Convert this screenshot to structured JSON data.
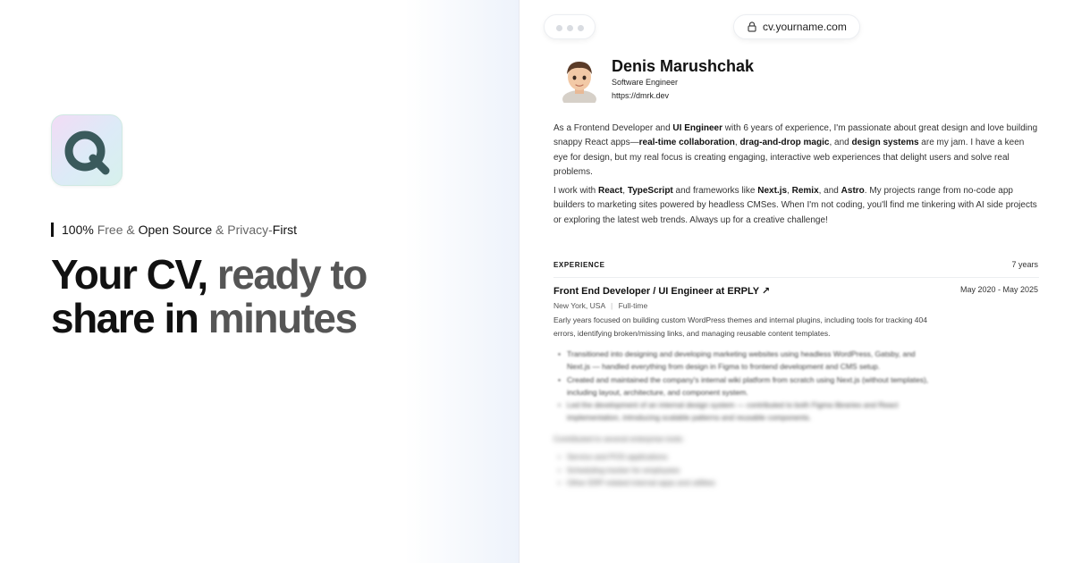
{
  "hero": {
    "tagline": {
      "part1": "100%",
      "part2": " Free & ",
      "part3": "Open Source",
      "part4": " & Privacy-",
      "part5": "First"
    },
    "headline": {
      "dark1": "Your CV,",
      "light1": " ready to",
      "dark2": "share in",
      "light2": " minutes"
    }
  },
  "browser": {
    "url": "cv.yourname.com"
  },
  "profile": {
    "name": "Denis Marushchak",
    "role": "Software Engineer",
    "website": "https://dmrk.dev"
  },
  "bio": {
    "p1": {
      "t1": "As a Frontend Developer and ",
      "b1": "UI Engineer",
      "t2": " with 6 years of experience, I'm passionate about great design and love building snappy React apps—",
      "b2": "real-time collaboration",
      "t3": ", ",
      "b3": "drag-and-drop magic",
      "t4": ", and ",
      "b4": "design systems",
      "t5": " are my jam. I have a keen eye for design, but my real focus is creating engaging, interactive web experiences that delight users and solve real problems."
    },
    "p2": {
      "t1": "I work with ",
      "b1": "React",
      "t2": ", ",
      "b2": "TypeScript",
      "t3": " and frameworks like ",
      "b3": "Next.js",
      "t4": ", ",
      "b4": "Remix",
      "t5": ", and ",
      "b5": "Astro",
      "t6": ". My projects range from no-code app builders to marketing sites powered by headless CMSes. When I'm not coding, you'll find me tinkering with AI side projects or exploring the latest web trends. Always up for a creative challenge!"
    }
  },
  "experience": {
    "label": "EXPERIENCE",
    "total": "7 years",
    "job": {
      "title": "Front End Developer / UI Engineer at ERPLY",
      "arrow": "↗",
      "dates": "May 2020 - May 2025",
      "location": "New York, USA",
      "separator": "|",
      "type": "Full-time",
      "description": "Early years focused on building custom WordPress themes and internal plugins, including tools for tracking 404 errors, identifying broken/missing links, and managing reusable content templates.",
      "bullets": [
        "Transitioned into designing and developing marketing websites using headless WordPress, Gatsby, and Next.js — handled everything from design in Figma to frontend development and CMS setup.",
        "Created and maintained the company's internal wiki platform from scratch using Next.js (without templates), including layout, architecture, and component system.",
        "Led the development of an internal design system — contributed to both Figma libraries and React implementation, introducing scalable patterns and reusable components."
      ],
      "sub_heading": "Contributed to several enterprise tools:",
      "sub_bullets": [
        "Service and POS applications",
        "Scheduling tracker for employees",
        "Other ERP-related internal apps and utilities"
      ]
    }
  }
}
